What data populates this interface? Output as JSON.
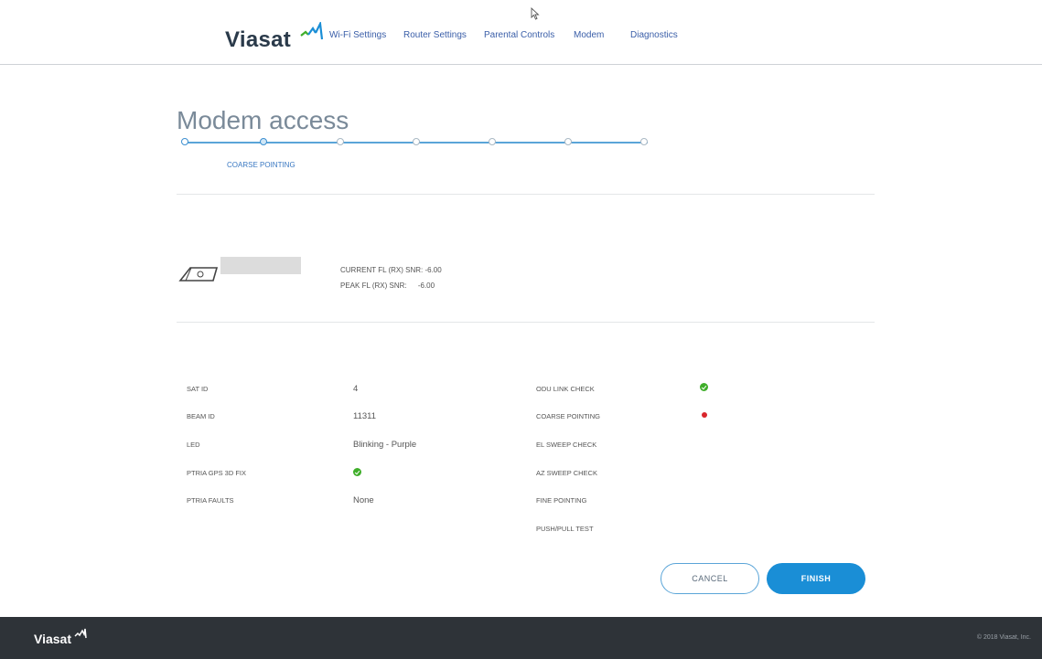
{
  "header": {
    "logo": "Viasat",
    "nav": [
      "Wi-Fi Settings",
      "Router Settings",
      "Parental Controls",
      "Modem",
      "Diagnostics"
    ]
  },
  "page_title": "Modem access",
  "stepper": {
    "current_step_label": "COARSE POINTING",
    "total_steps": 7,
    "current_step": 2
  },
  "signal": {
    "current_snr_label": "CURRENT FL (RX) SNR:",
    "current_snr_value": "-6.00",
    "peak_snr_label": "PEAK FL (RX) SNR:",
    "peak_snr_value": "-6.00"
  },
  "details": {
    "sat_id_label": "SAT ID",
    "sat_id_value": "4",
    "beam_id_label": "BEAM ID",
    "beam_id_value": "11311",
    "led_label": "LED",
    "led_value": "Blinking - Purple",
    "gps_label": "PTRIA GPS 3D FIX",
    "faults_label": "PTRIA FAULTS",
    "faults_value": "None"
  },
  "checks": {
    "odu_link": "ODU LINK CHECK",
    "coarse_pointing": "COARSE POINTING",
    "el_sweep": "EL SWEEP CHECK",
    "az_sweep": "AZ SWEEP CHECK",
    "fine_pointing": "FINE POINTING",
    "push_pull": "PUSH/PULL TEST"
  },
  "buttons": {
    "cancel": "CANCEL",
    "finish": "FINISH"
  },
  "footer": {
    "logo": "Viasat",
    "copyright": "© 2018 Viasat, Inc."
  },
  "colors": {
    "accent": "#1a8ed6",
    "ok": "#3fae2a",
    "error": "#d9262c",
    "footer": "#2e3338"
  }
}
